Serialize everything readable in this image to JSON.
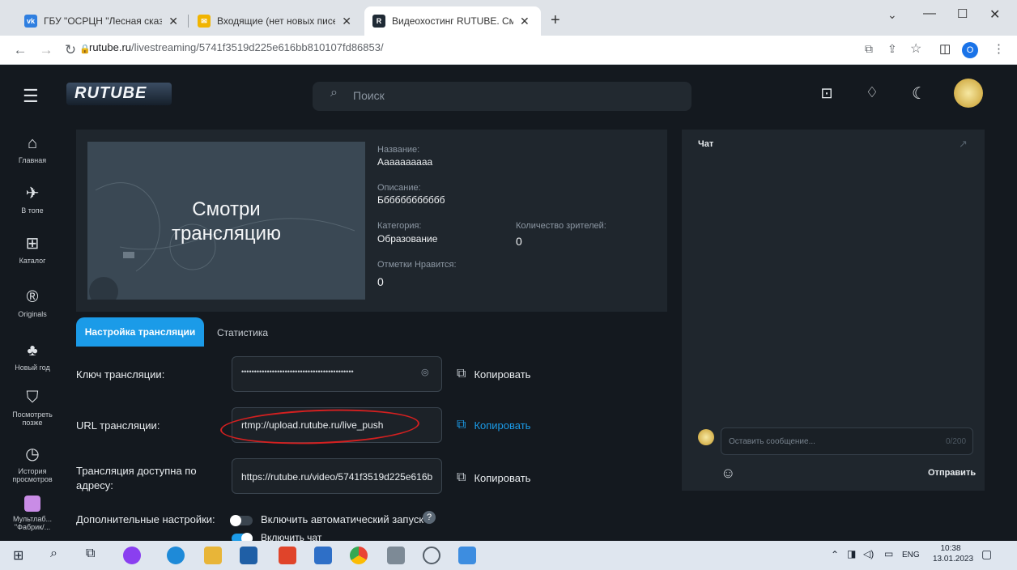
{
  "browser": {
    "tabs": [
      {
        "title": "ГБУ \"ОСРЦН \"Лесная сказка\" (г",
        "favicon": "vk-icon"
      },
      {
        "title": "Входящие (нет новых писем) —",
        "favicon": "mail-icon"
      },
      {
        "title": "Видеохостинг RUTUBE. Смотри",
        "favicon": "rutube-icon"
      }
    ],
    "url_host": "rutube.ru",
    "url_path": "/livestreaming/5741f3519d225e616bb810107fd86853/",
    "profile_letter": "O"
  },
  "header": {
    "logo": "RUTUBE",
    "search_placeholder": "Поиск"
  },
  "sidebar": {
    "items": [
      {
        "label": "Главная",
        "icon": "home-icon"
      },
      {
        "label": "В топе",
        "icon": "rocket-icon"
      },
      {
        "label": "Каталог",
        "icon": "grid-icon"
      },
      {
        "label": "Originals",
        "icon": "originals-icon"
      },
      {
        "label": "Новый год",
        "icon": "tree-icon"
      },
      {
        "label": "Посмотреть позже",
        "icon": "bookmark-icon"
      },
      {
        "label": "История просмотров",
        "icon": "history-icon"
      },
      {
        "label": "Мультлаб... \"Фабрик/...",
        "icon": "channel-icon"
      }
    ]
  },
  "stream": {
    "poster_text_1": "Смотри",
    "poster_text_2": "трансляцию",
    "name_label": "Название:",
    "name_value": "Аааааааааа",
    "desc_label": "Описание:",
    "desc_value": "Бббббббббббб",
    "category_label": "Категория:",
    "category_value": "Образование",
    "viewers_label": "Количество зрителей:",
    "viewers_value": "0",
    "likes_label": "Отметки Нравится:",
    "likes_value": "0"
  },
  "tabs": {
    "settings": "Настройка трансляции",
    "stats": "Статистика"
  },
  "settings": {
    "key_label": "Ключ трансляции:",
    "key_value": "••••••••••••••••••••••••••••••••••••••••••••",
    "url_label": "URL трансляции:",
    "url_value": "rtmp://upload.rutube.ru/live_push",
    "address_label": "Трансляция доступна по адресу:",
    "address_value": "https://rutube.ru/video/5741f3519d225e616b",
    "copy_label": "Копировать",
    "extra_label": "Дополнительные настройки:",
    "autostart_label": "Включить автоматический запуск",
    "chat_toggle_label": "Включить чат"
  },
  "chat": {
    "title": "Чат",
    "placeholder": "Оставить сообщение...",
    "counter": "0/200",
    "send": "Отправить"
  },
  "taskbar": {
    "lang": "ENG",
    "time": "10:38",
    "date": "13.01.2023"
  },
  "colors": {
    "accent": "#1b9be8",
    "background": "#14191f",
    "panel": "#1f262d",
    "annotation": "#d42020"
  }
}
